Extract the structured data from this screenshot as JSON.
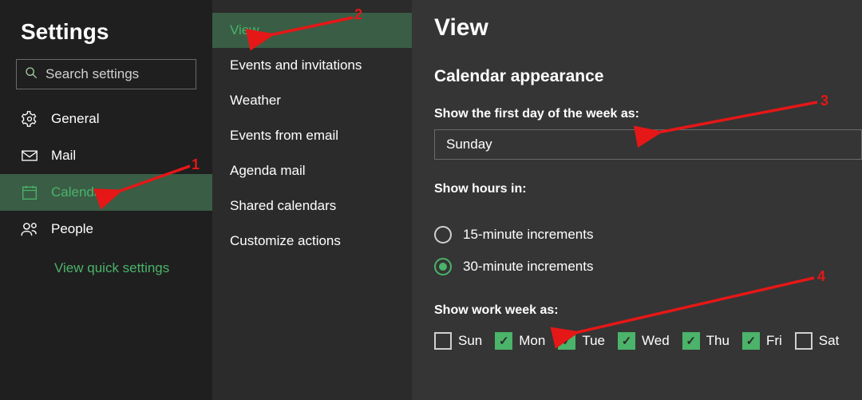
{
  "settings": {
    "title": "Settings",
    "search_placeholder": "Search settings",
    "nav": [
      {
        "icon": "gear",
        "label": "General"
      },
      {
        "icon": "mail",
        "label": "Mail"
      },
      {
        "icon": "calendar",
        "label": "Calendar",
        "active": true
      },
      {
        "icon": "people",
        "label": "People"
      }
    ],
    "quick_settings_label": "View quick settings"
  },
  "submenu": {
    "items": [
      {
        "label": "View",
        "active": true
      },
      {
        "label": "Events and invitations"
      },
      {
        "label": "Weather"
      },
      {
        "label": "Events from email"
      },
      {
        "label": "Agenda mail"
      },
      {
        "label": "Shared calendars"
      },
      {
        "label": "Customize actions"
      }
    ]
  },
  "panel": {
    "title": "View",
    "section_title": "Calendar appearance",
    "first_day": {
      "label": "Show the first day of the week as:",
      "value": "Sunday"
    },
    "hours": {
      "label": "Show hours in:",
      "options": [
        {
          "label": "15-minute increments",
          "selected": false
        },
        {
          "label": "30-minute increments",
          "selected": true
        }
      ]
    },
    "work_week": {
      "label": "Show work week as:",
      "days": [
        {
          "abbr": "Sun",
          "on": false
        },
        {
          "abbr": "Mon",
          "on": true
        },
        {
          "abbr": "Tue",
          "on": true
        },
        {
          "abbr": "Wed",
          "on": true
        },
        {
          "abbr": "Thu",
          "on": true
        },
        {
          "abbr": "Fri",
          "on": true
        },
        {
          "abbr": "Sat",
          "on": false
        }
      ]
    }
  },
  "annotations": [
    {
      "n": "1"
    },
    {
      "n": "2"
    },
    {
      "n": "3"
    },
    {
      "n": "4"
    }
  ]
}
